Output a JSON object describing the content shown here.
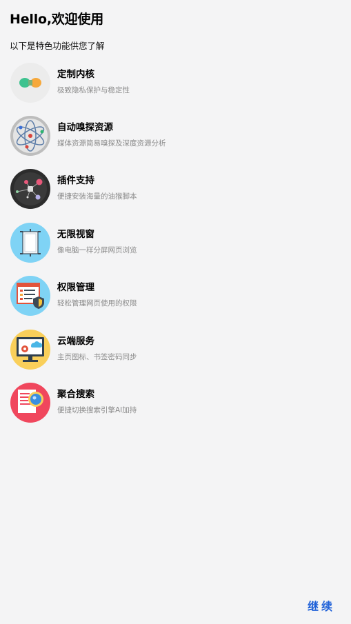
{
  "header": {
    "title": "Hello,欢迎使用",
    "subtitle": "以下是特色功能供您了解"
  },
  "features": [
    {
      "icon": "kernel-icon",
      "name": "定制内核",
      "desc": "极致隐私保护与稳定性"
    },
    {
      "icon": "atom-sniff-icon",
      "name": "自动嗅探资源",
      "desc": "媒体资源简易嗅探及深度资源分析"
    },
    {
      "icon": "plugin-network-icon",
      "name": "插件支持",
      "desc": "便捷安装海量的油猴脚本"
    },
    {
      "icon": "window-icon",
      "name": "无限视窗",
      "desc": "像电脑一样分屏网页浏览"
    },
    {
      "icon": "permission-shield-icon",
      "name": "权限管理",
      "desc": "轻松管理网页使用的权限"
    },
    {
      "icon": "cloud-sync-icon",
      "name": "云端服务",
      "desc": "主页图标、书签密码同步"
    },
    {
      "icon": "search-magnifier-icon",
      "name": "聚合搜索",
      "desc": "便捷切换搜索引擎AI加持"
    }
  ],
  "footer": {
    "continue_label": "继续"
  },
  "colors": {
    "accent": "#1e60d8",
    "background": "#f4f4f5"
  }
}
